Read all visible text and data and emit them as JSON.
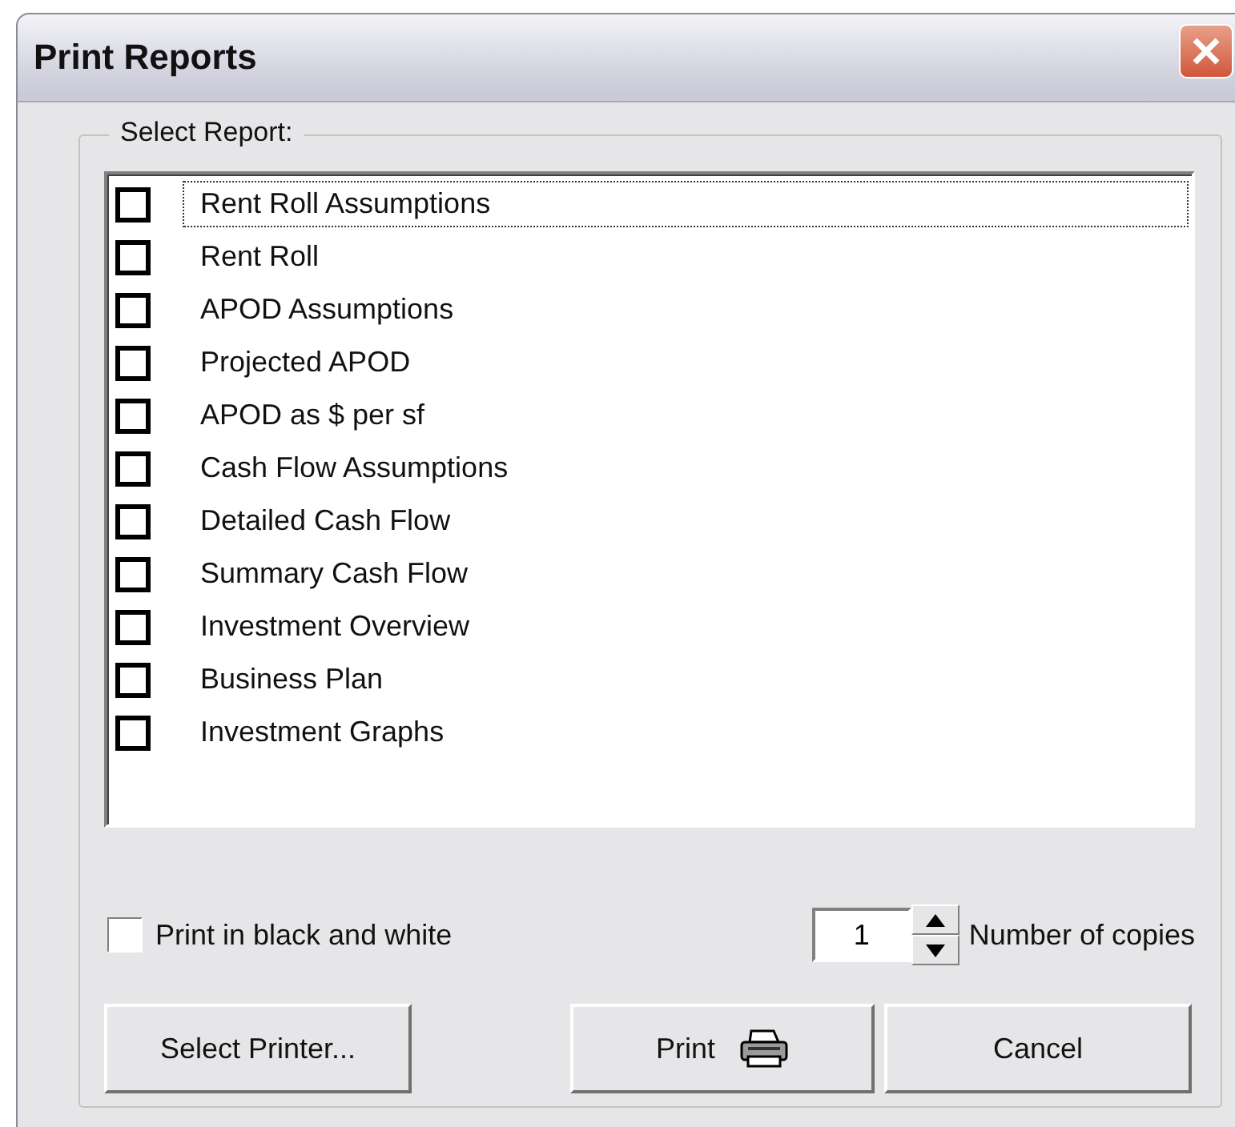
{
  "window": {
    "title": "Print Reports"
  },
  "report_group": {
    "label": "Select Report:",
    "items": [
      {
        "label": "Rent Roll Assumptions",
        "checked": false,
        "focused": true
      },
      {
        "label": "Rent Roll",
        "checked": false,
        "focused": false
      },
      {
        "label": "APOD Assumptions",
        "checked": false,
        "focused": false
      },
      {
        "label": "Projected APOD",
        "checked": false,
        "focused": false
      },
      {
        "label": "APOD as $ per sf",
        "checked": false,
        "focused": false
      },
      {
        "label": "Cash Flow Assumptions",
        "checked": false,
        "focused": false
      },
      {
        "label": "Detailed Cash Flow",
        "checked": false,
        "focused": false
      },
      {
        "label": "Summary Cash Flow",
        "checked": false,
        "focused": false
      },
      {
        "label": "Investment Overview",
        "checked": false,
        "focused": false
      },
      {
        "label": "Business Plan",
        "checked": false,
        "focused": false
      },
      {
        "label": "Investment Graphs",
        "checked": false,
        "focused": false
      }
    ]
  },
  "black_and_white": {
    "label": "Print in black and white",
    "checked": false
  },
  "copies": {
    "value": "1",
    "label": "Number of copies"
  },
  "buttons": [
    {
      "label": "Select Printer...",
      "kind": "plain"
    },
    {
      "label": "Print",
      "kind": "print"
    },
    {
      "label": "Cancel",
      "kind": "plain"
    }
  ]
}
